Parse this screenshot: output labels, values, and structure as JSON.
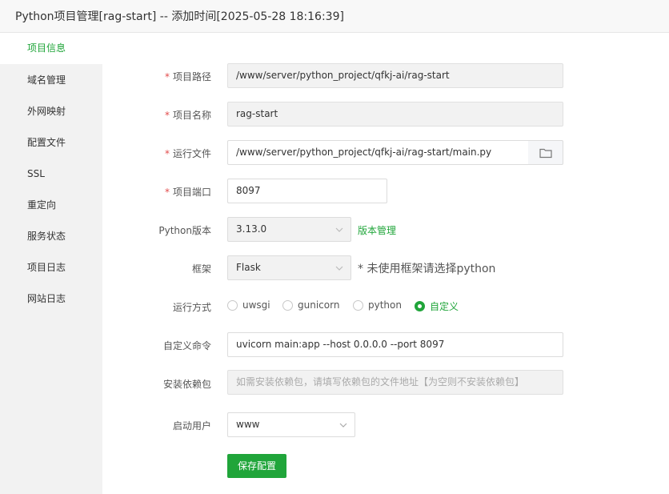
{
  "window": {
    "title": "Python项目管理[rag-start] -- 添加时间[2025-05-28 18:16:39]"
  },
  "sidebar": {
    "items": [
      {
        "label": "项目信息"
      },
      {
        "label": "域名管理"
      },
      {
        "label": "外网映射"
      },
      {
        "label": "配置文件"
      },
      {
        "label": "SSL"
      },
      {
        "label": "重定向"
      },
      {
        "label": "服务状态"
      },
      {
        "label": "项目日志"
      },
      {
        "label": "网站日志"
      }
    ],
    "active": "项目信息"
  },
  "form": {
    "required_mark": "*",
    "project_path": {
      "label": "项目路径",
      "value": "/www/server/python_project/qfkj-ai/rag-start"
    },
    "project_name": {
      "label": "项目名称",
      "value": "rag-start"
    },
    "run_file": {
      "label": "运行文件",
      "value": "/www/server/python_project/qfkj-ai/rag-start/main.py"
    },
    "project_port": {
      "label": "项目端口",
      "value": "8097"
    },
    "python_version": {
      "label": "Python版本",
      "value": "3.13.0",
      "manage_link": "版本管理"
    },
    "framework": {
      "label": "框架",
      "value": "Flask",
      "note": "* 未使用框架请选择python"
    },
    "run_mode": {
      "label": "运行方式",
      "options": [
        "uwsgi",
        "gunicorn",
        "python",
        "自定义"
      ],
      "selected": "自定义"
    },
    "custom_command": {
      "label": "自定义命令",
      "value": "uvicorn main:app --host 0.0.0.0 --port 8097"
    },
    "install_deps": {
      "label": "安装依赖包",
      "placeholder": "如需安装依赖包，请填写依赖包的文件地址【为空则不安装依赖包】"
    },
    "run_user": {
      "label": "启动用户",
      "value": "www"
    },
    "save_label": "保存配置"
  },
  "colors": {
    "accent": "#20a53a",
    "required": "#e24c4c"
  }
}
